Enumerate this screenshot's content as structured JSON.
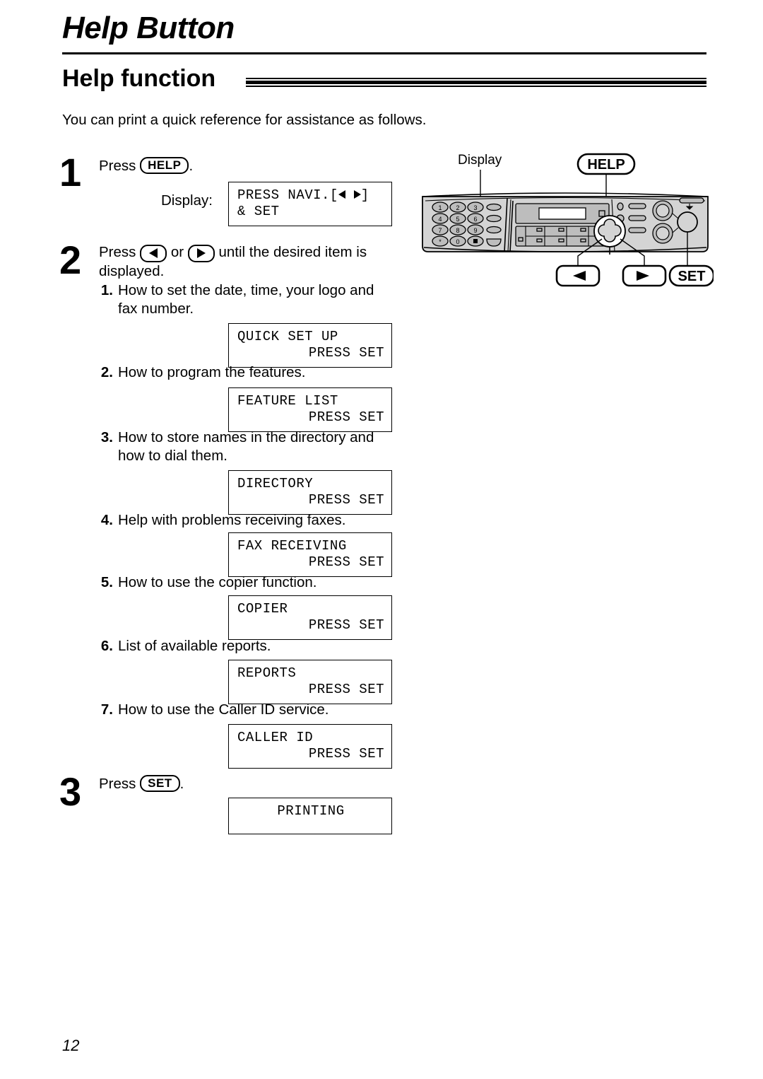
{
  "page": {
    "title": "Help Button",
    "section_title": "Help function",
    "intro": "You can print a quick reference for assistance as follows.",
    "page_number": "12"
  },
  "steps": [
    {
      "number": "1",
      "press_label": "Press",
      "key": "HELP",
      "period": ".",
      "display_label": "Display:",
      "lcd": {
        "line1": "PRESS NAVI.[",
        "line1_end": "]",
        "line2": "& SET"
      }
    },
    {
      "number": "2",
      "text_before": "Press",
      "text_or": "or",
      "text_after": "until the desired item is displayed.",
      "items": [
        {
          "n": "1.",
          "text": "How to set the date, time, your logo and fax number.",
          "lcd_line1": "QUICK SET UP",
          "lcd_line2": "PRESS SET"
        },
        {
          "n": "2.",
          "text": "How to program the features.",
          "lcd_line1": "FEATURE LIST",
          "lcd_line2": "PRESS SET"
        },
        {
          "n": "3.",
          "text": "How to store names in the directory and how to dial them.",
          "lcd_line1": "DIRECTORY",
          "lcd_line2": "PRESS SET"
        },
        {
          "n": "4.",
          "text": "Help with problems receiving faxes.",
          "lcd_line1": "FAX RECEIVING",
          "lcd_line2": "PRESS SET"
        },
        {
          "n": "5.",
          "text": "How to use the copier function.",
          "lcd_line1": "COPIER",
          "lcd_line2": "PRESS SET"
        },
        {
          "n": "6.",
          "text": "List of available reports.",
          "lcd_line1": "REPORTS",
          "lcd_line2": "PRESS SET"
        },
        {
          "n": "7.",
          "text": "How to use the Caller ID service.",
          "lcd_line1": "CALLER ID",
          "lcd_line2": "PRESS SET"
        }
      ]
    },
    {
      "number": "3",
      "press_label": "Press",
      "key": "SET",
      "period": ".",
      "lcd": {
        "line1": "PRINTING"
      }
    }
  ],
  "illustration": {
    "display_callout": "Display",
    "help_callout": "HELP",
    "set_callout": "SET",
    "left_arrow_callout": "left-arrow",
    "right_arrow_callout": "right-arrow",
    "keypad": [
      "1",
      "2",
      "3",
      "4",
      "5",
      "6",
      "7",
      "8",
      "9",
      "*",
      "0",
      "#"
    ],
    "colors": {
      "panel": "#d4d4d4",
      "panel_dark": "#bdbdbd",
      "outline": "#000000",
      "lcd": "#ffffff"
    }
  }
}
